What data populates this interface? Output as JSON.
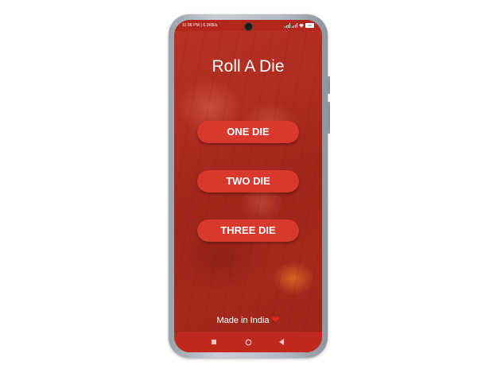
{
  "status_bar": {
    "left_text": "11:06 PM | 6.3KB/s",
    "battery_text": "100"
  },
  "app": {
    "title": "Roll A Die",
    "buttons": {
      "one": "ONE DIE",
      "two": "TWO DIE",
      "three": "THREE DIE"
    },
    "footer_text": "Made in India"
  },
  "colors": {
    "accent": "#d9392c",
    "status_bar": "#b3261b",
    "nav_bar": "#c0291d",
    "heart": "#e0281c"
  },
  "icons": {
    "heart": "heart-icon",
    "recent": "recent-apps-icon",
    "home": "home-icon",
    "back": "back-icon"
  }
}
